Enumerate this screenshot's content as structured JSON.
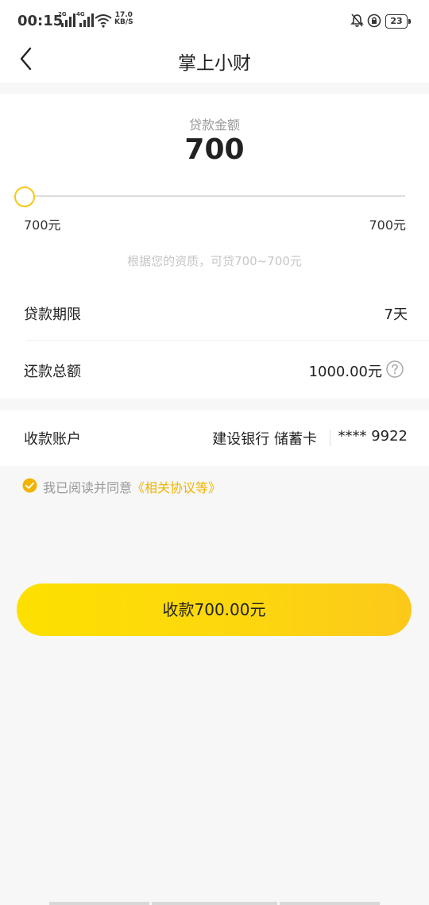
{
  "status_bar": {
    "time": "00:15",
    "sim1_label": "2G",
    "sim2_label": "4G",
    "net_speed_value": "17.0",
    "net_speed_unit": "KB/S",
    "battery_level": "23"
  },
  "nav": {
    "title": "掌上小财"
  },
  "loan": {
    "amount_label": "贷款金额",
    "amount_value": "700",
    "slider_min": "700元",
    "slider_max": "700元",
    "slider_position": 0,
    "eligibility_note": "根据您的资质，可贷700~700元",
    "term_label": "贷款期限",
    "term_value": "7天",
    "total_repay_label": "还款总额",
    "total_repay_value": "1000.00元"
  },
  "account": {
    "label": "收款账户",
    "bank": "建设银行 储蓄卡",
    "card_number": "**** 9922"
  },
  "agreement": {
    "text": "我已阅读并同意",
    "link": "《相关协议等》",
    "checked": true
  },
  "submit": {
    "label": "收款700.00元"
  },
  "colors": {
    "accent": "#f6c713",
    "button_start": "#fde000",
    "button_end": "#fcc81a",
    "link": "#f0b400"
  }
}
